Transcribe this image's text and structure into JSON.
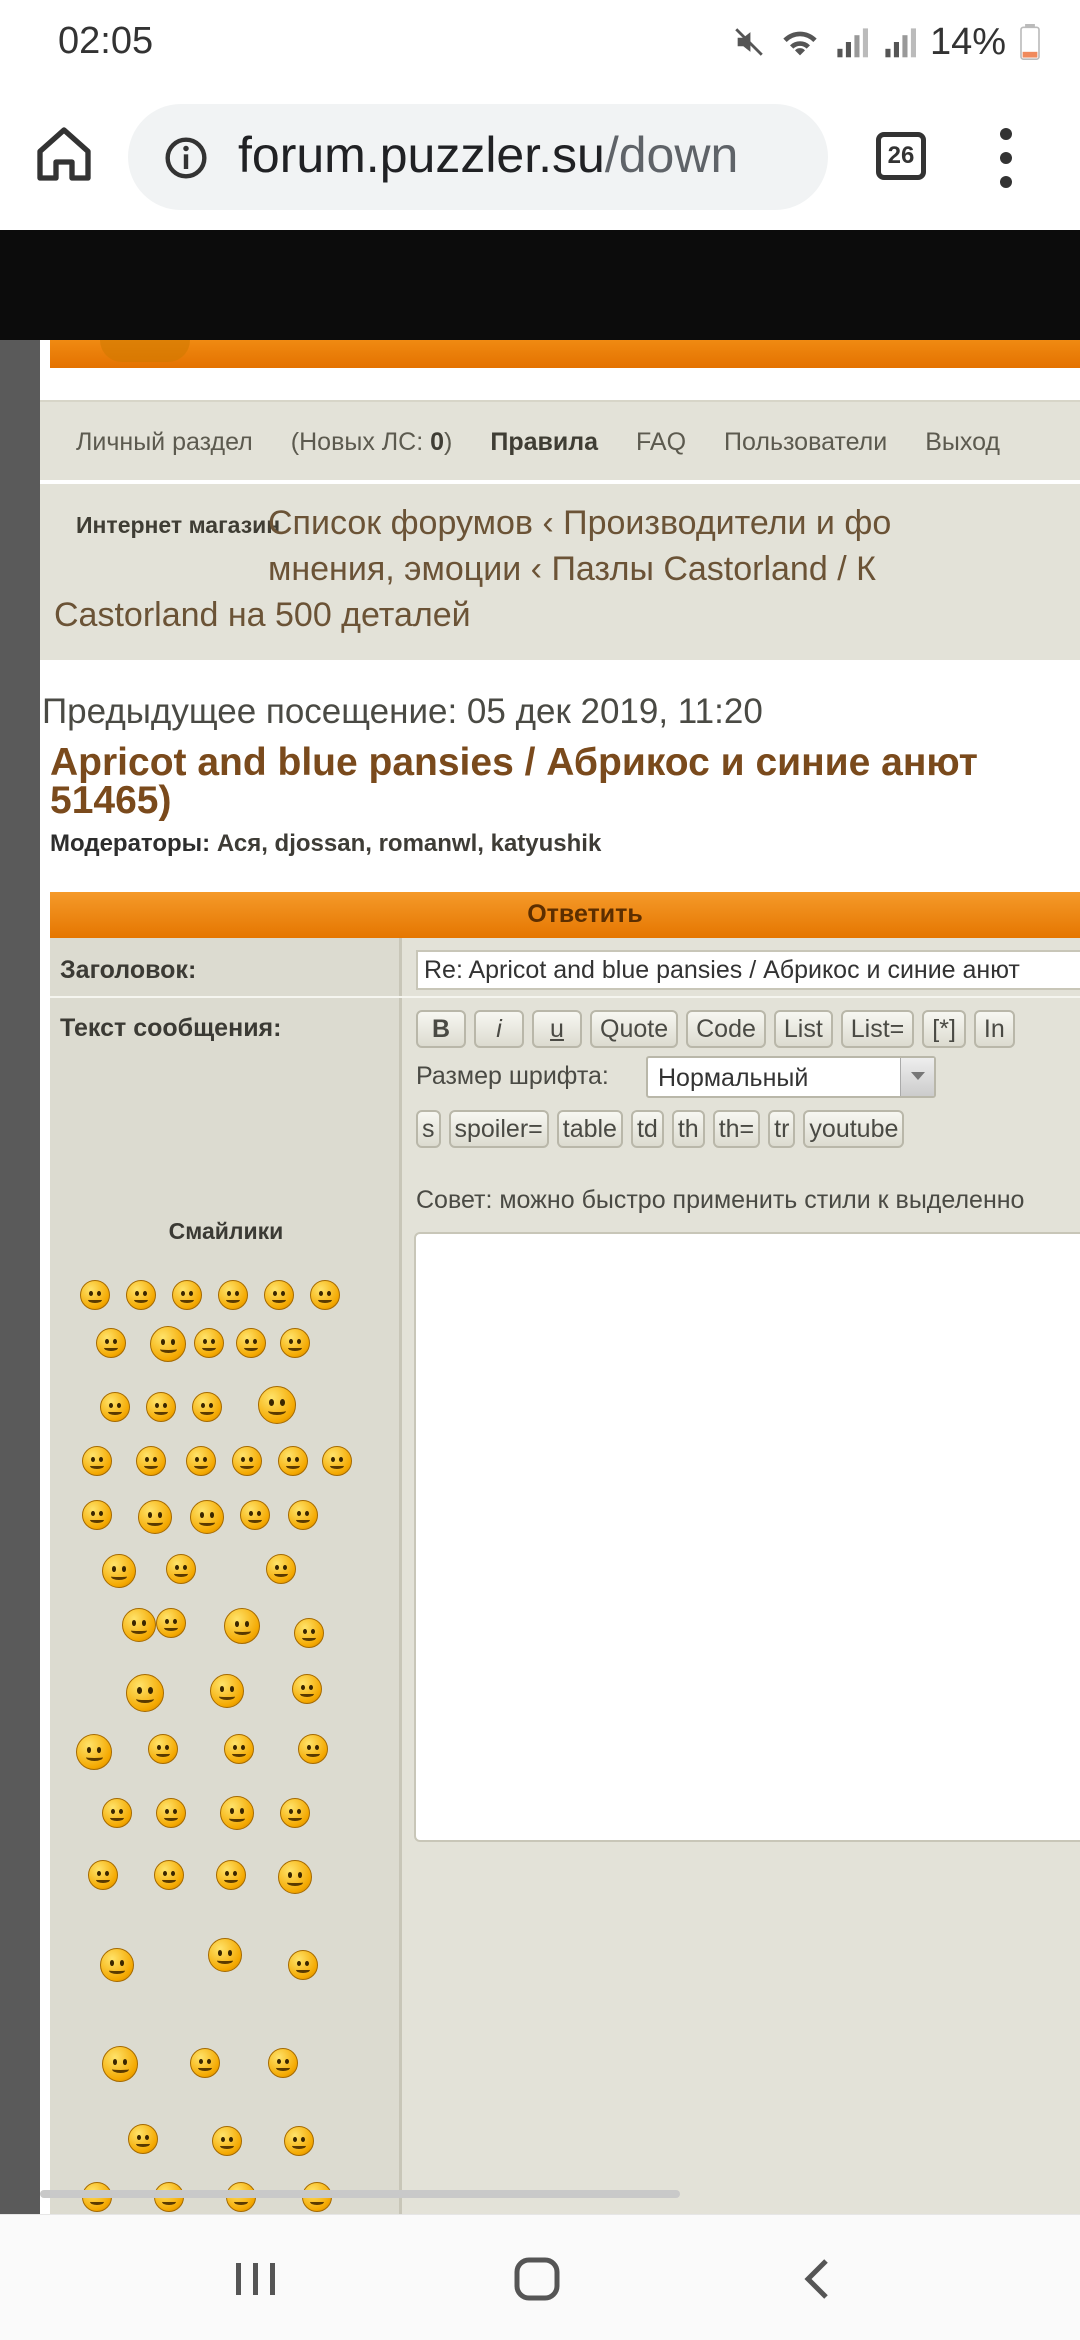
{
  "status_bar": {
    "time": "02:05",
    "battery": "14%"
  },
  "browser": {
    "url_host": "forum.puzzler.su",
    "url_path": "/down",
    "tab_count": "26"
  },
  "nav": {
    "items": [
      "Личный раздел",
      "(Новых ЛС: ",
      "0",
      ")",
      "Правила",
      "FAQ",
      "Пользователи",
      "Выход"
    ]
  },
  "breadcrumbs": {
    "shop": "Интернет магазин",
    "line1": "Список форумов ‹ Производители и фо",
    "line2": "мнения, эмоции ‹ Пазлы Castorland / К",
    "line3": "Castorland на 500 деталей"
  },
  "page": {
    "last_visit": "Предыдущее посещение: 05 дек 2019, 11:20",
    "title_line1": "Apricot and blue pansies / Абрикос и синие анют",
    "title_line2": "51465)",
    "moderators_label": "Модераторы:",
    "moderators": "Ася, djossan, romanwl, katyushik"
  },
  "form": {
    "header": "Ответить",
    "subject_label": "Заголовок:",
    "subject_value": "Re: Apricot and blue pansies / Абрикос и синие анют",
    "message_label": "Текст сообщения:",
    "smileys_label": "Смайлики",
    "buttons_row1": [
      "B",
      "i",
      "u",
      "Quote",
      "Code",
      "List",
      "List=",
      "[*]",
      "In"
    ],
    "font_size_label": "Размер шрифта:",
    "font_size_value": "Нормальный",
    "buttons_row2": [
      "s",
      "spoiler=",
      "table",
      "td",
      "th",
      "th=",
      "tr",
      "youtube"
    ],
    "tip": "Совет: можно быстро применить стили к выделенно"
  },
  "colors": {
    "accent_orange": "#e57600",
    "panel_bg": "#e3e2d8",
    "title_brown": "#7a4a1c"
  }
}
